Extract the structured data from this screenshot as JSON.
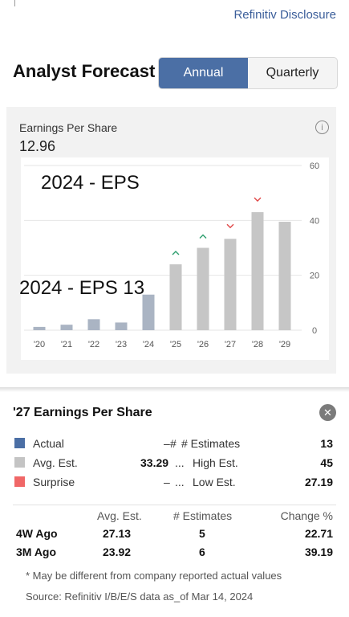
{
  "header": {
    "disclosure_link": "Refinitiv Disclosure"
  },
  "title": "Analyst Forecast",
  "tabs": [
    {
      "label": "Annual",
      "active": true
    },
    {
      "label": "Quarterly",
      "active": false
    }
  ],
  "metric": {
    "label": "Earnings Per Share",
    "value": "12.96",
    "info_icon": "info-icon"
  },
  "overlay_texts": [
    "2024 - EPS",
    "2024 - EPS 13"
  ],
  "chart_data": {
    "type": "bar",
    "categories": [
      "'20",
      "'21",
      "'22",
      "'23",
      "'24",
      "'25",
      "'26",
      "'27",
      "'28",
      "'29"
    ],
    "values": [
      1.2,
      2.0,
      4.0,
      2.8,
      12.96,
      24.0,
      30.0,
      33.29,
      43.0,
      39.5
    ],
    "actual_through_index": 4,
    "markers": [
      "",
      "",
      "",
      "",
      "",
      "up",
      "up",
      "down",
      "down",
      ""
    ],
    "ylim": [
      0,
      60
    ],
    "yticks": [
      "0",
      "20",
      "40",
      "60"
    ],
    "colors": {
      "actual": "#aab4c3",
      "estimate": "#c6c6c6",
      "up": "#2e9e6e",
      "down": "#e04848",
      "grid": "#e6e6e6"
    }
  },
  "detail": {
    "title": "'27 Earnings Per Share",
    "legend": [
      {
        "label": "Actual",
        "value": "–",
        "color": "#4b6fa5"
      },
      {
        "label": "Avg. Est.",
        "value": "33.29",
        "color": "#c4c4c4"
      },
      {
        "label": "Surprise",
        "value": "–",
        "color": "#f06767"
      }
    ],
    "stats": [
      {
        "label": "# Estimates",
        "value": "13"
      },
      {
        "label": "High Est.",
        "value": "45"
      },
      {
        "label": "Low Est.",
        "value": "27.19"
      }
    ],
    "table": {
      "headers": [
        "Avg. Est.",
        "# Estimates",
        "Change %"
      ],
      "rows": [
        {
          "period": "4W Ago",
          "avg": "27.13",
          "count": "5",
          "change": "22.71"
        },
        {
          "period": "3M Ago",
          "avg": "23.92",
          "count": "6",
          "change": "39.19"
        }
      ]
    },
    "footnote": "* May be different from company reported actual values",
    "source": "Source: Refinitiv I/B/E/S data as_of Mar 14, 2024"
  }
}
